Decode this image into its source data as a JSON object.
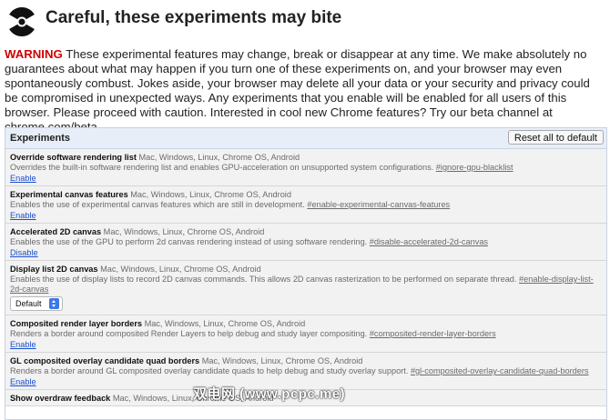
{
  "header": {
    "icon": "radiation-icon",
    "title": "Careful, these experiments may bite"
  },
  "warning": {
    "label": "WARNING",
    "text": "These experimental features may change, break or disappear at any time. We make absolutely no guarantees about what may happen if you turn one of these experiments on, and your browser may even spontaneously combust. Jokes aside, your browser may delete all your data or your security and privacy could be compromised in unexpected ways. Any experiments that you enable will be enabled for all users of this browser. Please proceed with caution. Interested in cool new Chrome features? Try our beta channel at chrome.com/beta."
  },
  "panel": {
    "title": "Experiments",
    "reset_label": "Reset all to default"
  },
  "experiments": [
    {
      "name": "Override software rendering list",
      "platforms": "Mac, Windows, Linux, Chrome OS, Android",
      "description": "Overrides the built-in software rendering list and enables GPU-acceleration on unsupported system configurations.",
      "link": "#ignore-gpu-blacklist",
      "action": "Enable"
    },
    {
      "name": "Experimental canvas features",
      "platforms": "Mac, Windows, Linux, Chrome OS, Android",
      "description": "Enables the use of experimental canvas features which are still in development.",
      "link": "#enable-experimental-canvas-features",
      "action": "Enable"
    },
    {
      "name": "Accelerated 2D canvas",
      "platforms": "Mac, Windows, Linux, Chrome OS, Android",
      "description": "Enables the use of the GPU to perform 2d canvas rendering instead of using software rendering.",
      "link": "#disable-accelerated-2d-canvas",
      "action": "Disable"
    },
    {
      "name": "Display list 2D canvas",
      "platforms": "Mac, Windows, Linux, Chrome OS, Android",
      "description": "Enables the use of display lists to record 2D canvas commands. This allows 2D canvas rasterization to be performed on separate thread.",
      "link": "#enable-display-list-2d-canvas",
      "select_value": "Default"
    },
    {
      "name": "Composited render layer borders",
      "platforms": "Mac, Windows, Linux, Chrome OS, Android",
      "description": "Renders a border around composited Render Layers to help debug and study layer compositing.",
      "link": "#composited-render-layer-borders",
      "action": "Enable"
    },
    {
      "name": "GL composited overlay candidate quad borders",
      "platforms": "Mac, Windows, Linux, Chrome OS, Android",
      "description": "Renders a border around GL composited overlay candidate quads to help debug and study overlay support.",
      "link": "#gl-composited-overlay-candidate-quad-borders",
      "action": "Enable"
    },
    {
      "name": "Show overdraw feedback",
      "platforms": "Mac, Windows, Linux, Chrome OS, Android",
      "description": "",
      "link": ""
    }
  ],
  "watermark": "双电网 (www.pcpc.me)"
}
